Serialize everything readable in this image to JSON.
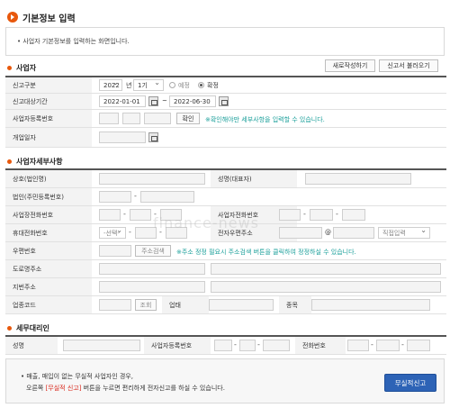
{
  "title": "기본정보 입력",
  "notice": "• 사업자 기본정보를 입력하는 화면입니다.",
  "business": {
    "section_title": "사업자",
    "new_button": "새로작성하기",
    "load_button": "신고서 불러오기",
    "report_type_label": "신고구분",
    "year": "2022",
    "year_unit": "년",
    "period": "1기",
    "radio_scheduled": "예정",
    "radio_final": "확정",
    "period_label": "신고대상기간",
    "date_from": "2022-01-01",
    "date_sep": "~",
    "date_to": "2022-06-30",
    "reg_no_label": "사업자등록번호",
    "confirm_button": "확인",
    "reg_hint": "※확인해야만 세부사항을 입력할 수 있습니다.",
    "open_date_label": "개업일자"
  },
  "detail": {
    "section_title": "사업자세부사항",
    "company_label": "상호(법인명)",
    "owner_label": "성명(대표자)",
    "corp_no_label": "법인(주민등록번호)",
    "biz_phone_label": "사업장전화번호",
    "home_phone_label": "사업자전화번호",
    "mobile_label": "휴대전화번호",
    "mobile_select": "-선택-",
    "email_label": "전자우편주소",
    "email_at": "@",
    "email_domain": "직접입력",
    "zip_label": "우편번호",
    "zip_button": "주소검색",
    "zip_hint": "※주소 정정 필요시 주소검색 버튼을 클릭하여 정정하실 수 있습니다.",
    "road_label": "도로명주소",
    "lot_label": "지번주소",
    "industry_label": "업종코드",
    "lookup_button": "조회",
    "type_label": "업태",
    "item_label": "종목"
  },
  "agent": {
    "section_title": "세무대리인",
    "name_label": "성명",
    "reg_no_label": "사업자등록번호",
    "phone_label": "전화번호"
  },
  "bottom": {
    "line1_prefix": "• 매출, 매입이 없는 무실적 사업자인 경우,",
    "line2_prefix": "오른쪽 ",
    "line2_red": "[무실적 신고]",
    "line2_suffix": " 버튼을 누르면 편리하게 전자신고를 하실 수 있습니다.",
    "submit_button": "무실적신고"
  },
  "watermark": "finance-news",
  "colors": {
    "accent": "#e8580c",
    "primary_button": "#2d63b6",
    "hint": "#1a9f9a",
    "alert": "#d9271b"
  }
}
